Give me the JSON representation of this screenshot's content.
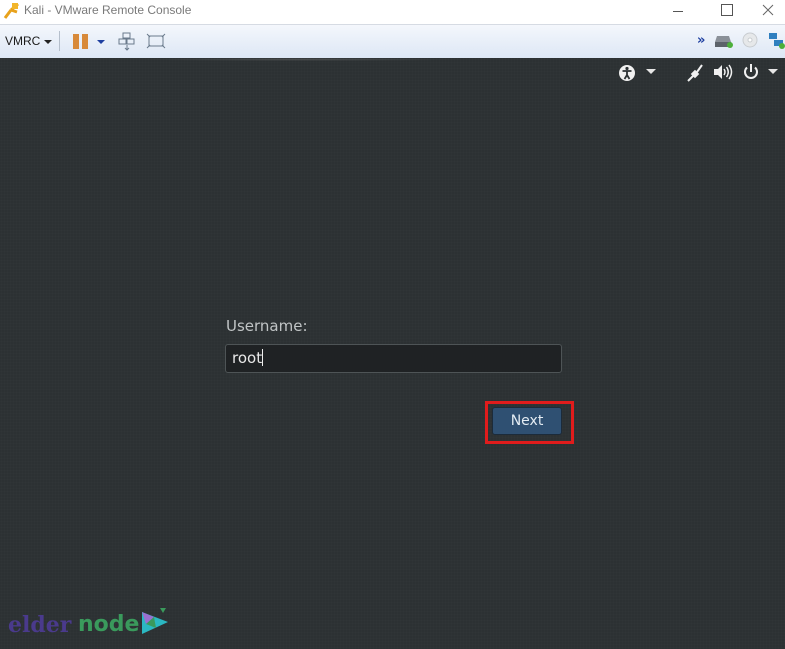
{
  "window": {
    "title": "Kali - VMware Remote Console",
    "controls": {
      "minimize": "minimize",
      "maximize": "maximize",
      "close": "close"
    }
  },
  "toolbar": {
    "menu_label": "VMRC",
    "icons": [
      "pause-icon",
      "send-ctrl-alt-del-icon",
      "fullscreen-icon",
      "more-icon",
      "hard-disk-icon",
      "cd-dvd-icon",
      "network-adapter-icon"
    ]
  },
  "vm": {
    "top_bar_icons": [
      "accessibility-icon",
      "wired-network-icon",
      "volume-icon",
      "power-icon"
    ],
    "login": {
      "label": "Username:",
      "value": "root",
      "button": "Next"
    }
  },
  "watermark": {
    "part1": "elder",
    "part2": "node",
    "colors": {
      "elder": "#4a3a8c",
      "node": "#3a9a5c"
    }
  },
  "colors": {
    "highlight": "#e01c1c",
    "button": "#2f5072",
    "background": "#2c3133"
  }
}
